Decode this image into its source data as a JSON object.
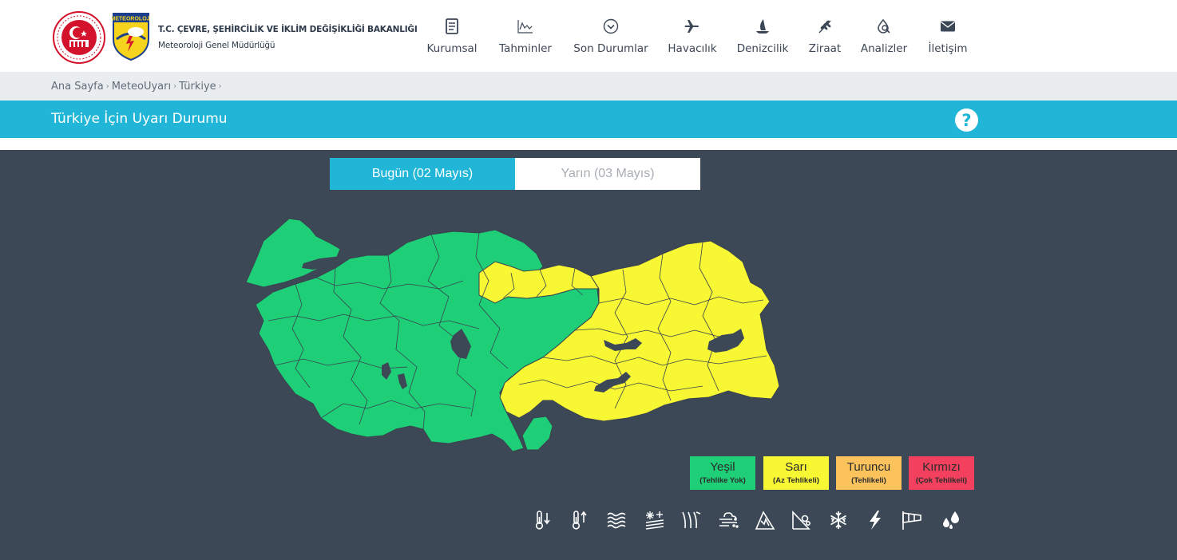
{
  "header": {
    "ministry": "T.C. ÇEVRE, ŞEHİRCİLİK VE İKLİM DEĞİŞİKLİĞİ BAKANLIĞI",
    "directorate": "Meteoroloji Genel Müdürlüğü",
    "mgm_logo_text": "METEOROLOJİ"
  },
  "nav": [
    {
      "label": "Kurumsal",
      "icon": "document-icon"
    },
    {
      "label": "Tahminler",
      "icon": "chart-icon"
    },
    {
      "label": "Son Durumlar",
      "icon": "chevron-circle-icon"
    },
    {
      "label": "Havacılık",
      "icon": "airplane-icon"
    },
    {
      "label": "Denizcilik",
      "icon": "sailboat-icon"
    },
    {
      "label": "Ziraat",
      "icon": "wheat-icon"
    },
    {
      "label": "Analizler",
      "icon": "drop-search-icon"
    },
    {
      "label": "İletişim",
      "icon": "envelope-icon"
    }
  ],
  "breadcrumb": [
    "Ana Sayfa",
    "MeteoUyarı",
    "Türkiye"
  ],
  "breadcrumb_separator": "›",
  "page_title": "Türkiye İçin Uyarı Durumu",
  "help_label": "?",
  "tabs": {
    "today": "Bugün (02 Mayıs)",
    "tomorrow": "Yarın (03 Mayıs)",
    "active": "today"
  },
  "legend": [
    {
      "name": "Yeşil",
      "desc": "(Tehlike Yok)",
      "color": "#1ecf78"
    },
    {
      "name": "Sarı",
      "desc": "(Az Tehlikeli)",
      "color": "#f7f733"
    },
    {
      "name": "Turuncu",
      "desc": "(Tehlikeli)",
      "color": "#fcc35c"
    },
    {
      "name": "Kırmızı",
      "desc": "(Çok Tehlikeli)",
      "color": "#f2405e"
    }
  ],
  "map_colors": {
    "green": "#1ecf78",
    "yellow": "#f7f733",
    "lake": "#3d4856"
  },
  "hazard_icons": [
    "cold-icon",
    "heat-icon",
    "fog-icon",
    "snow-melt-icon",
    "wind-icon",
    "dust-icon",
    "avalanche-icon",
    "landslide-icon",
    "snowflake-icon",
    "lightning-icon",
    "windsock-icon",
    "rain-icon"
  ]
}
